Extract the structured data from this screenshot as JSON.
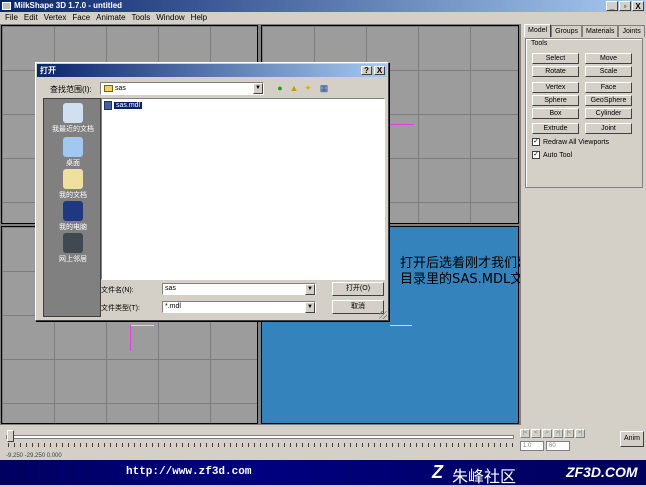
{
  "window": {
    "title": "MilkShape 3D 1.7.0 - untitled",
    "buttons": [
      "_",
      "▫",
      "X"
    ]
  },
  "menu": [
    "File",
    "Edit",
    "Vertex",
    "Face",
    "Animate",
    "Tools",
    "Window",
    "Help"
  ],
  "panel": {
    "tabs": [
      "Model",
      "Groups",
      "Materials",
      "Joints"
    ],
    "group_label": "Tools",
    "tools": [
      "Select",
      "Move",
      "Rotate",
      "Scale",
      "Vertex",
      "Face",
      "Sphere",
      "GeoSphere",
      "Box",
      "Cylinder",
      "Extrude",
      "Joint"
    ],
    "checkboxes": [
      {
        "label": "Redraw All Viewports",
        "checked": true
      },
      {
        "label": "Auto Tool",
        "checked": true
      }
    ]
  },
  "timeline": {
    "frame_buttons": [
      "|<",
      "<",
      ">",
      ">|",
      "|<",
      ">|"
    ],
    "frame_field_1": "1.0",
    "frame_field_2": "60",
    "anim_label": "Anim",
    "status": "-9.250 -29.250 0.000"
  },
  "dialog": {
    "title": "打开",
    "title_buttons": [
      "?",
      "X"
    ],
    "lookin_label": "查找范围(I):",
    "lookin_value": "sas",
    "nav_icons": [
      "back-icon",
      "up-folder-icon",
      "new-folder-icon",
      "view-menu-icon"
    ],
    "places": [
      "我最近的文档",
      "桌面",
      "我的文档",
      "我的电脑",
      "网上邻居"
    ],
    "files": [
      "sas.mdl"
    ],
    "filename_label": "文件名(N):",
    "filename_value": "sas",
    "filetype_label": "文件类型(T):",
    "filetype_value": "*.mdl",
    "open_button": "打开(O)",
    "cancel_button": "取消"
  },
  "annotation": {
    "line1": "打开后选着刚才我们建立的工程",
    "line2": "目录里的SAS.MDL文件"
  },
  "banner": {
    "url": "http://www.zf3d.com",
    "logo_letter": "Z",
    "name_cn": "朱峰社区",
    "site": "ZF3D.COM"
  }
}
